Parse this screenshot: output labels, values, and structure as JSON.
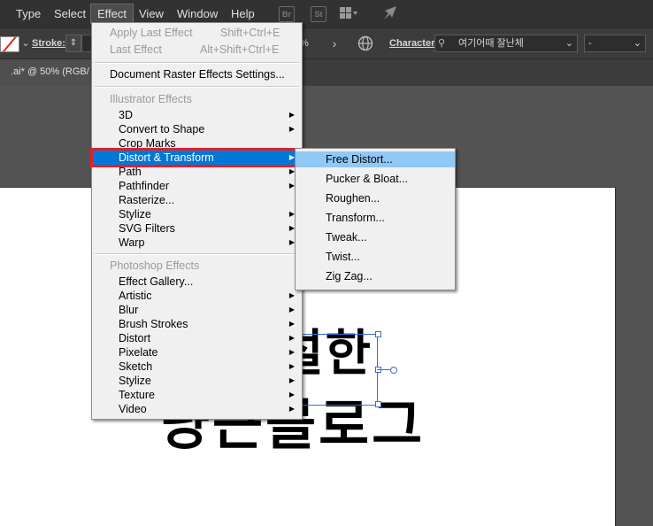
{
  "menubar": {
    "items": [
      "Type",
      "Select",
      "Effect",
      "View",
      "Window",
      "Help"
    ],
    "bridge_label": "Br",
    "stock_label": "St"
  },
  "controlbar": {
    "stroke_label": "Stroke:",
    "opacity_fragment": "%",
    "character_label": "Character:",
    "font_value": "여기어때 잘난체",
    "font_size_value": "-"
  },
  "document": {
    "tab_title": ".ai* @ 50% (RGB/"
  },
  "artwork": {
    "line1": "설한",
    "line2": "냥근블로그"
  },
  "effect_menu": {
    "apply_last": "Apply Last Effect",
    "apply_last_shortcut": "Shift+Ctrl+E",
    "last_effect": "Last Effect",
    "last_effect_shortcut": "Alt+Shift+Ctrl+E",
    "raster_settings": "Document Raster Effects Settings...",
    "illustrator_header": "Illustrator Effects",
    "illustrator_items": [
      "3D",
      "Convert to Shape",
      "Crop Marks",
      "Distort & Transform",
      "Path",
      "Pathfinder",
      "Rasterize...",
      "Stylize",
      "SVG Filters",
      "Warp"
    ],
    "photoshop_header": "Photoshop Effects",
    "photoshop_items": [
      "Effect Gallery...",
      "Artistic",
      "Blur",
      "Brush Strokes",
      "Distort",
      "Pixelate",
      "Sketch",
      "Stylize",
      "Texture",
      "Video"
    ]
  },
  "distort_submenu": {
    "items": [
      "Free Distort...",
      "Pucker & Bloat...",
      "Roughen...",
      "Transform...",
      "Tweak...",
      "Twist...",
      "Zig Zag..."
    ]
  },
  "colors": {
    "menu_highlight": "#0078d7",
    "submenu_highlight": "#90c8f6",
    "focus_ring": "#e0202a",
    "selection": "#3a6ad8"
  }
}
